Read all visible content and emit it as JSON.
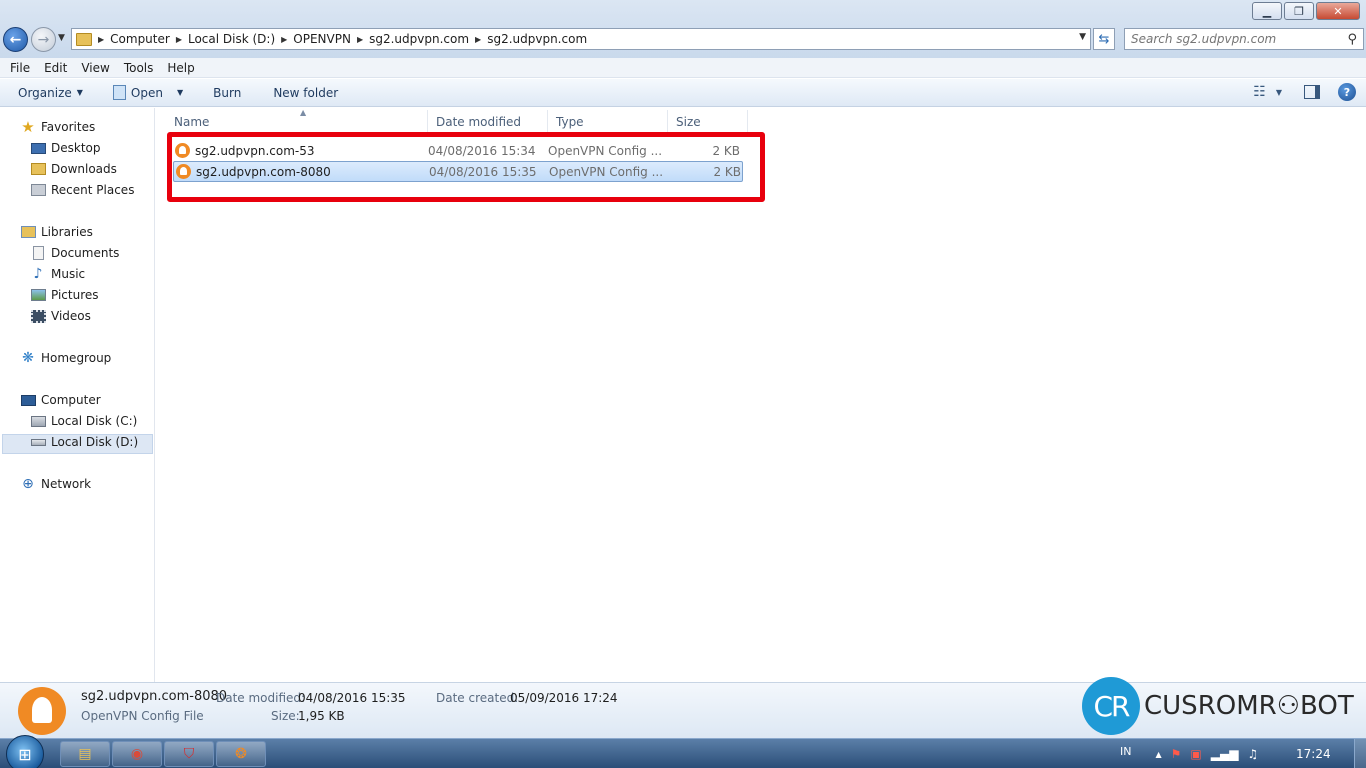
{
  "window": {
    "minimize_glyph": "▁",
    "maximize_glyph": "❐",
    "close_glyph": "✕"
  },
  "navigation": {
    "back_glyph": "←",
    "forward_glyph": "→",
    "recent_glyph": "▼",
    "refresh_glyph": "⇆"
  },
  "address": {
    "crumbs": [
      "Computer",
      "Local Disk (D:)",
      "OPENVPN",
      "sg2.udpvpn.com",
      "sg2.udpvpn.com"
    ],
    "separator": "▶",
    "dropdown_glyph": "▼"
  },
  "search": {
    "placeholder": "Search sg2.udpvpn.com",
    "icon": "search-icon",
    "icon_glyph": "⚲"
  },
  "menu": [
    "File",
    "Edit",
    "View",
    "Tools",
    "Help"
  ],
  "toolbar": {
    "organize": "Organize",
    "open": "Open",
    "burn": "Burn",
    "new_folder": "New folder",
    "caret": "▼",
    "view_glyph": "☷",
    "help_glyph": "?"
  },
  "navpane": {
    "favorites": "Favorites",
    "desktop": "Desktop",
    "downloads": "Downloads",
    "recent_places": "Recent Places",
    "libraries": "Libraries",
    "documents": "Documents",
    "music": "Music",
    "pictures": "Pictures",
    "videos": "Videos",
    "homegroup": "Homegroup",
    "computer": "Computer",
    "local_c": "Local Disk (C:)",
    "local_d": "Local Disk (D:)",
    "network": "Network"
  },
  "columns": {
    "name": "Name",
    "date": "Date modified",
    "type": "Type",
    "size": "Size",
    "sort_glyph": "▲"
  },
  "files": [
    {
      "name": "sg2.udpvpn.com-53",
      "date": "04/08/2016 15:34",
      "type": "OpenVPN Config ...",
      "size": "2 KB"
    },
    {
      "name": "sg2.udpvpn.com-8080",
      "date": "04/08/2016 15:35",
      "type": "OpenVPN Config ...",
      "size": "2 KB"
    }
  ],
  "details": {
    "filename": "sg2.udpvpn.com-8080",
    "filetype": "OpenVPN Config File",
    "modified_label": "Date modified:",
    "modified_value": "04/08/2016 15:35",
    "created_label": "Date created:",
    "created_value": "05/09/2016 17:24",
    "size_label": "Size:",
    "size_value": "1,95 KB"
  },
  "watermark": {
    "badge": "CR",
    "text": "CUSROMR⚇BOT"
  },
  "taskbar": {
    "start_glyph": "⊞",
    "explorer_glyph": "▤",
    "chrome_glyph": "◉",
    "shield_glyph": "⛉",
    "app_glyph": "❂"
  },
  "tray": {
    "language": "IN",
    "arrow_glyph": "▲",
    "time": "17:24"
  }
}
